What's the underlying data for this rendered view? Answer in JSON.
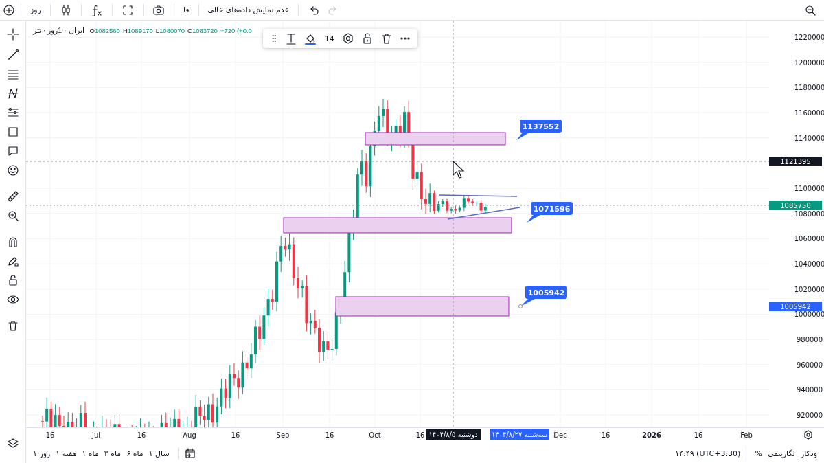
{
  "toolbar": {
    "interval": "روز",
    "language": "فا",
    "empty_data_toggle": "عدم نمایش داده‌های خالی",
    "redo_disabled": true
  },
  "legend": {
    "title": "ایران · 1روز · تتر",
    "values": [
      {
        "label": "O",
        "value": "1082560"
      },
      {
        "label": "H",
        "value": "1089170"
      },
      {
        "label": "L",
        "value": "1080070"
      },
      {
        "label": "C",
        "value": "1083720"
      }
    ],
    "change": "+720 (+0.0"
  },
  "drawing_toolbar": {
    "font_size": "14"
  },
  "price_axis": {
    "ticks": [
      "1220000",
      "1200000",
      "1180000",
      "1160000",
      "1140000",
      "1100000",
      "1080000",
      "1060000",
      "1040000",
      "1020000",
      "1000000",
      "980000",
      "960000",
      "940000",
      "920000"
    ],
    "markers": [
      {
        "kind": "crosshair",
        "text": "1121395"
      },
      {
        "kind": "last",
        "text": "1085750"
      },
      {
        "kind": "alert",
        "text": "1005942"
      }
    ]
  },
  "callouts": [
    "1137552",
    "1071596",
    "1005942"
  ],
  "time_axis": {
    "ticks": [
      {
        "text": "16",
        "bold": false
      },
      {
        "text": "Jul",
        "bold": false
      },
      {
        "text": "16",
        "bold": false
      },
      {
        "text": "Aug",
        "bold": false
      },
      {
        "text": "16",
        "bold": false
      },
      {
        "text": "Sep",
        "bold": false
      },
      {
        "text": "16",
        "bold": false
      },
      {
        "text": "Oct",
        "bold": false
      },
      {
        "text": "16",
        "bold": false
      },
      {
        "text": "Dec",
        "bold": false
      },
      {
        "text": "16",
        "bold": false
      },
      {
        "text": "2026",
        "bold": true
      },
      {
        "text": "16",
        "bold": false
      },
      {
        "text": "Feb",
        "bold": false
      }
    ],
    "markers": [
      {
        "kind": "selected",
        "text": "سه‌شنبه ۱۴۰۴/۸/۲۷"
      },
      {
        "kind": "crosshair",
        "text": "دوشنبه ۱۴۰۴/۸/۵"
      }
    ]
  },
  "range_buttons": [
    "سال ۱",
    "ماه ۶",
    "ماه ۳",
    "ماه ۱",
    "هفته ۱",
    "روز ۱"
  ],
  "status_bar": {
    "time": "۱۴:۴۹ (UTC+3:30)",
    "percent": "%",
    "log": "لگاریتمی",
    "auto": "ودکار"
  }
}
